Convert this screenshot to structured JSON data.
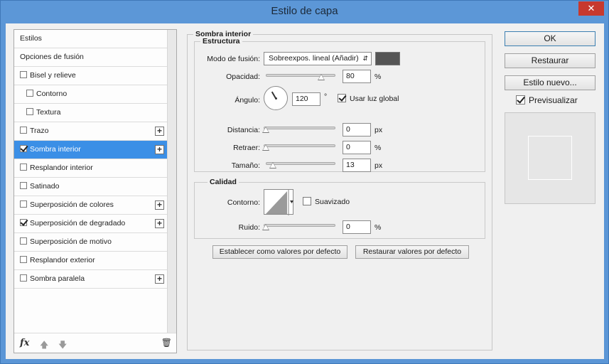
{
  "window": {
    "title": "Estilo de capa",
    "close_label": "✕"
  },
  "list": {
    "items": [
      {
        "label": "Estilos",
        "checkbox": false,
        "checked": false,
        "sub": false,
        "plus": false,
        "selected": false
      },
      {
        "label": "Opciones de fusión",
        "checkbox": false,
        "checked": false,
        "sub": false,
        "plus": false,
        "selected": false
      },
      {
        "label": "Bisel y relieve",
        "checkbox": true,
        "checked": false,
        "sub": false,
        "plus": false,
        "selected": false
      },
      {
        "label": "Contorno",
        "checkbox": true,
        "checked": false,
        "sub": true,
        "plus": false,
        "selected": false
      },
      {
        "label": "Textura",
        "checkbox": true,
        "checked": false,
        "sub": true,
        "plus": false,
        "selected": false
      },
      {
        "label": "Trazo",
        "checkbox": true,
        "checked": false,
        "sub": false,
        "plus": true,
        "selected": false
      },
      {
        "label": "Sombra interior",
        "checkbox": true,
        "checked": true,
        "sub": false,
        "plus": true,
        "selected": true
      },
      {
        "label": "Resplandor interior",
        "checkbox": true,
        "checked": false,
        "sub": false,
        "plus": false,
        "selected": false
      },
      {
        "label": "Satinado",
        "checkbox": true,
        "checked": false,
        "sub": false,
        "plus": false,
        "selected": false
      },
      {
        "label": "Superposición de colores",
        "checkbox": true,
        "checked": false,
        "sub": false,
        "plus": true,
        "selected": false
      },
      {
        "label": "Superposición de degradado",
        "checkbox": true,
        "checked": true,
        "sub": false,
        "plus": true,
        "selected": false
      },
      {
        "label": "Superposición de motivo",
        "checkbox": true,
        "checked": false,
        "sub": false,
        "plus": false,
        "selected": false
      },
      {
        "label": "Resplandor exterior",
        "checkbox": true,
        "checked": false,
        "sub": false,
        "plus": false,
        "selected": false
      },
      {
        "label": "Sombra paralela",
        "checkbox": true,
        "checked": false,
        "sub": false,
        "plus": true,
        "selected": false
      }
    ],
    "footer": {
      "fx_label": "fx",
      "up_icon": "arrow-up-icon",
      "down_icon": "arrow-down-icon",
      "trash_icon": "trash-icon"
    }
  },
  "panel": {
    "title": "Sombra interior",
    "structure": {
      "title": "Estructura",
      "blend_mode_label": "Modo de fusión:",
      "blend_mode_value": "Sobreexpos. lineal (Añadir)",
      "shadow_color": "#555555",
      "opacity_label": "Opacidad:",
      "opacity_value": "80",
      "opacity_unit": "%",
      "angle_label": "Ángulo:",
      "angle_value": "120",
      "angle_unit": "°",
      "global_light_label": "Usar luz global",
      "distance_label": "Distancia:",
      "distance_value": "0",
      "distance_unit": "px",
      "choke_label": "Retraer:",
      "choke_value": "0",
      "choke_unit": "%",
      "size_label": "Tamaño:",
      "size_value": "13",
      "size_unit": "px"
    },
    "quality": {
      "title": "Calidad",
      "contour_label": "Contorno:",
      "antialias_label": "Suavizado",
      "noise_label": "Ruido:",
      "noise_value": "0",
      "noise_unit": "%"
    },
    "make_default_label": "Establecer como valores por defecto",
    "reset_default_label": "Restaurar valores por defecto"
  },
  "side": {
    "ok_label": "OK",
    "reset_label": "Restaurar",
    "new_style_label": "Estilo nuevo...",
    "preview_label": "Previsualizar"
  }
}
